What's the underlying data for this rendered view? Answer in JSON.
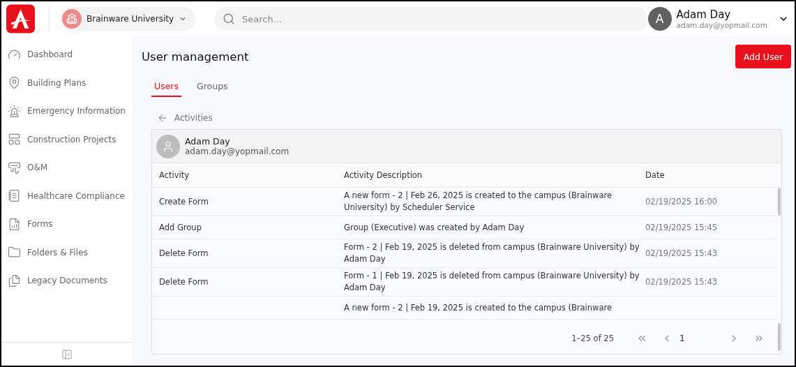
{
  "header": {
    "campus": "Brainware University",
    "search": {
      "placeholder": "Search..."
    },
    "user": {
      "initial": "A",
      "name": "Adam Day",
      "email": "adam.day@yopmail.com"
    }
  },
  "sidebar": {
    "items": [
      {
        "label": "Dashboard"
      },
      {
        "label": "Building Plans"
      },
      {
        "label": "Emergency Information"
      },
      {
        "label": "Construction Projects"
      },
      {
        "label": "O&M"
      },
      {
        "label": "Healthcare Compliance"
      },
      {
        "label": "Forms"
      },
      {
        "label": "Folders & Files"
      },
      {
        "label": "Legacy Documents"
      }
    ]
  },
  "page": {
    "title": "User management",
    "add_button": "Add User",
    "tabs": [
      {
        "label": "Users",
        "selected": true
      },
      {
        "label": "Groups",
        "selected": false
      }
    ],
    "back_label": "Activities"
  },
  "activity_card": {
    "user": {
      "name": "Adam Day",
      "email": "adam.day@yopmail.com"
    },
    "table": {
      "columns": [
        "Activity",
        "Activity Description",
        "Date"
      ],
      "rows": [
        {
          "activity": "Create Form",
          "description": "A new form - 2 | Feb 26, 2025 is created to the campus (Brainware University) by Scheduler Service",
          "date": "02/19/2025 16:00"
        },
        {
          "activity": "Add Group",
          "description": "Group (Executive) was created by Adam Day",
          "date": "02/19/2025 15:45"
        },
        {
          "activity": "Delete Form",
          "description": "Form - 2 | Feb 19, 2025 is deleted from campus (Brainware University) by Adam Day",
          "date": "02/19/2025 15:43"
        },
        {
          "activity": "Delete Form",
          "description": "Form - 1 | Feb 19, 2025 is deleted from campus (Brainware University) by Adam Day",
          "date": "02/19/2025 15:43"
        },
        {
          "description": "A new form - 2 | Feb 19, 2025 is created to the campus (Brainware"
        }
      ]
    },
    "pagination": {
      "range": "1–25 of 25",
      "page": "1"
    }
  }
}
